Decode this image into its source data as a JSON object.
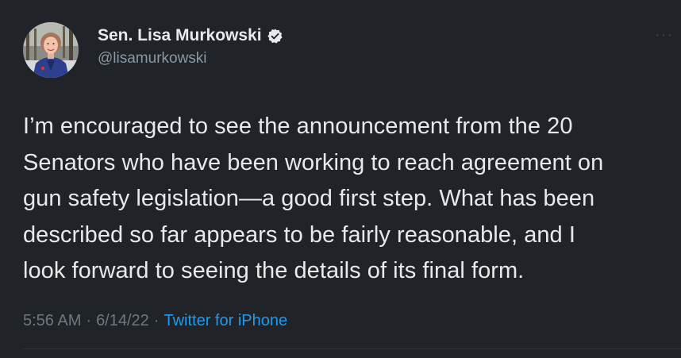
{
  "author": {
    "display_name": "Sen. Lisa Murkowski",
    "handle": "@lisamurkowski",
    "verified": true,
    "avatar_icon": "profile-photo"
  },
  "tweet": {
    "text": "I’m encouraged to see the announcement from the 20\nSenators who have been working to reach agreement on\ngun safety legislation—a good first step. What has been\ndescribed so far appears to be fairly reasonable, and I\nlook forward to seeing the details of its final form.",
    "time": "5:56 AM",
    "date": "6/14/22",
    "separator": "·",
    "source": "Twitter for iPhone"
  },
  "menu": {
    "more_icon": "ellipsis-icon",
    "more_glyph": "···"
  },
  "colors": {
    "background": "#202327",
    "text": "#e7e9ea",
    "secondary": "#8b98a5",
    "link": "#1d9bf0",
    "verified": "#e7e9ea"
  }
}
